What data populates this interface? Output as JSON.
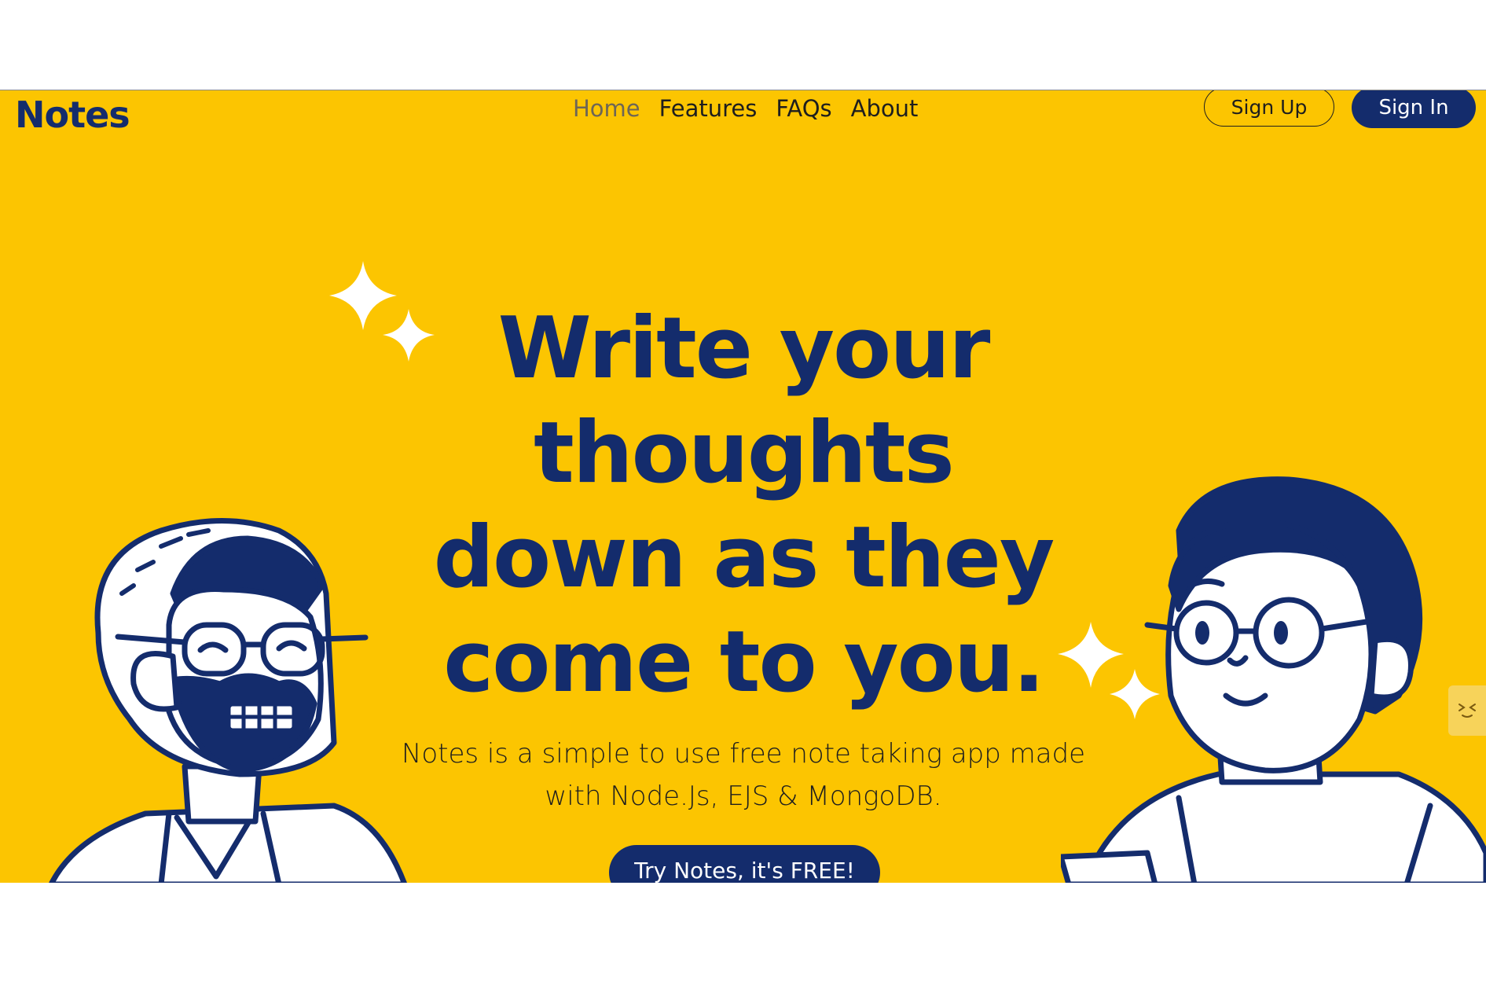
{
  "header": {
    "logo": "Notes",
    "nav": [
      {
        "label": "Home",
        "active": true
      },
      {
        "label": "Features",
        "active": false
      },
      {
        "label": "FAQs",
        "active": false
      },
      {
        "label": "About",
        "active": false
      }
    ],
    "sign_up": "Sign Up",
    "sign_in": "Sign In"
  },
  "hero": {
    "title_lines": [
      "Write your",
      "thoughts",
      "down as they",
      "come to you."
    ],
    "subtitle_lines": [
      "Notes is a simple to use free note taking app made",
      "with Node.Js, EJS & MongoDB."
    ],
    "cta": "Try Notes, it's FREE!"
  },
  "colors": {
    "background": "#fcc501",
    "primary": "#142c6c",
    "text": "#1e1e1e",
    "active_nav": "#6e6656"
  },
  "icons": [
    "sparkle-icon",
    "widget-face-icon"
  ]
}
